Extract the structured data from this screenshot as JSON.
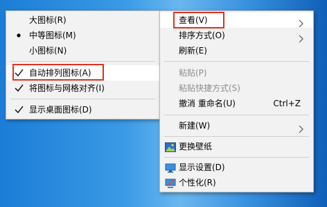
{
  "view_submenu": {
    "items": [
      {
        "label": "大图标(R)"
      },
      {
        "label": "中等图标(M)"
      },
      {
        "label": "小图标(N)"
      },
      {
        "label": "自动排列图标(A)"
      },
      {
        "label": "将图标与网格对齐(I)"
      },
      {
        "label": "显示桌面图标(D)"
      }
    ]
  },
  "context_menu": {
    "items": [
      {
        "label": "查看(V)"
      },
      {
        "label": "排序方式(O)"
      },
      {
        "label": "刷新(E)"
      },
      {
        "label": "粘贴(P)"
      },
      {
        "label": "粘贴快捷方式(S)"
      },
      {
        "label": "撤消 重命名(U)",
        "shortcut": "Ctrl+Z"
      },
      {
        "label": "新建(W)"
      },
      {
        "label": "更换壁纸"
      },
      {
        "label": "显示设置(D)"
      },
      {
        "label": "个性化(R)"
      }
    ]
  },
  "colors": {
    "highlight_border": "#e0301e",
    "hover_bg": "#ffffff",
    "menu_bg": "#f2f2f2",
    "disabled_text": "#8d8d8d"
  }
}
